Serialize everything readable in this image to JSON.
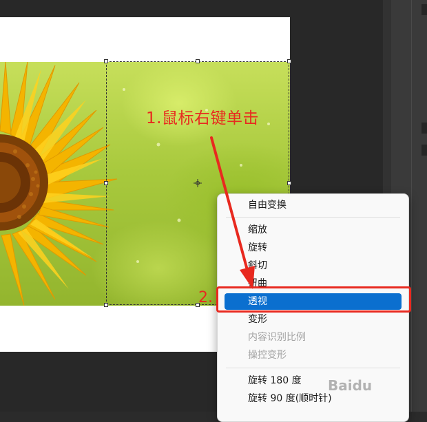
{
  "annotations": {
    "step1": "1.鼠标右键单击",
    "step2": "2."
  },
  "context_menu": {
    "items": [
      {
        "label": "自由变换",
        "state": "normal"
      },
      {
        "label": "缩放",
        "state": "normal"
      },
      {
        "label": "旋转",
        "state": "normal"
      },
      {
        "label": "斜切",
        "state": "normal"
      },
      {
        "label": "扭曲",
        "state": "normal"
      },
      {
        "label": "透视",
        "state": "selected"
      },
      {
        "label": "变形",
        "state": "normal"
      },
      {
        "label": "内容识别比例",
        "state": "disabled"
      },
      {
        "label": "操控变形",
        "state": "disabled"
      },
      {
        "label": "旋转 180 度",
        "state": "normal"
      },
      {
        "label": "旋转 90 度(顺时针)",
        "state": "normal"
      }
    ]
  },
  "watermark": "Baidu",
  "colors": {
    "annotation": "#e8291f",
    "selection": "#0b6fcf",
    "workspace": "#282828"
  }
}
